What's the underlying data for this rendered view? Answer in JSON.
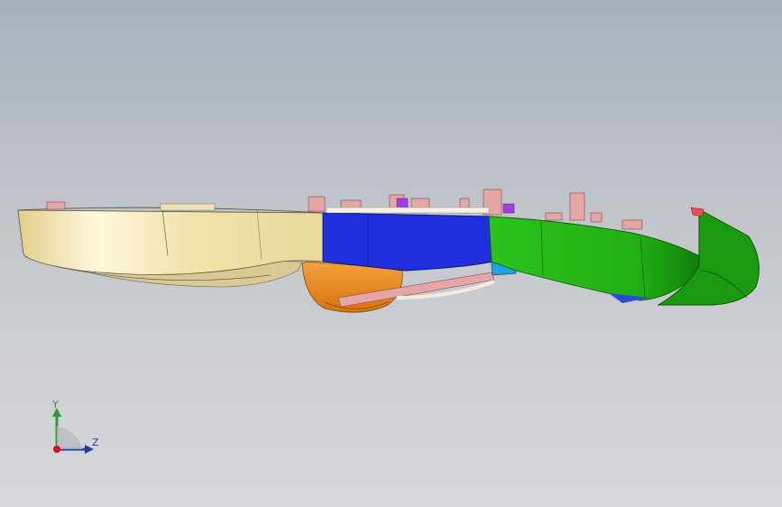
{
  "viewport": {
    "background_top": "#a9b0ba",
    "background_bottom": "#d7d8db"
  },
  "model": {
    "part_colors": {
      "shell": "#efe1a8",
      "shell_dark": "#c9b885",
      "blue_section": "#1f2fe0",
      "green_section": "#22b014",
      "green_dark": "#138a0a",
      "orange_part": "#e58a1c",
      "pink_detail": "#e7a6a6",
      "light_blue": "#1ea3e8",
      "purple_detail": "#a03fe0"
    }
  },
  "triad": {
    "y_label": "Y",
    "z_label": "Z",
    "y_color": "#2f9a2f",
    "z_color": "#2a3aa0",
    "origin_color": "#d11"
  }
}
